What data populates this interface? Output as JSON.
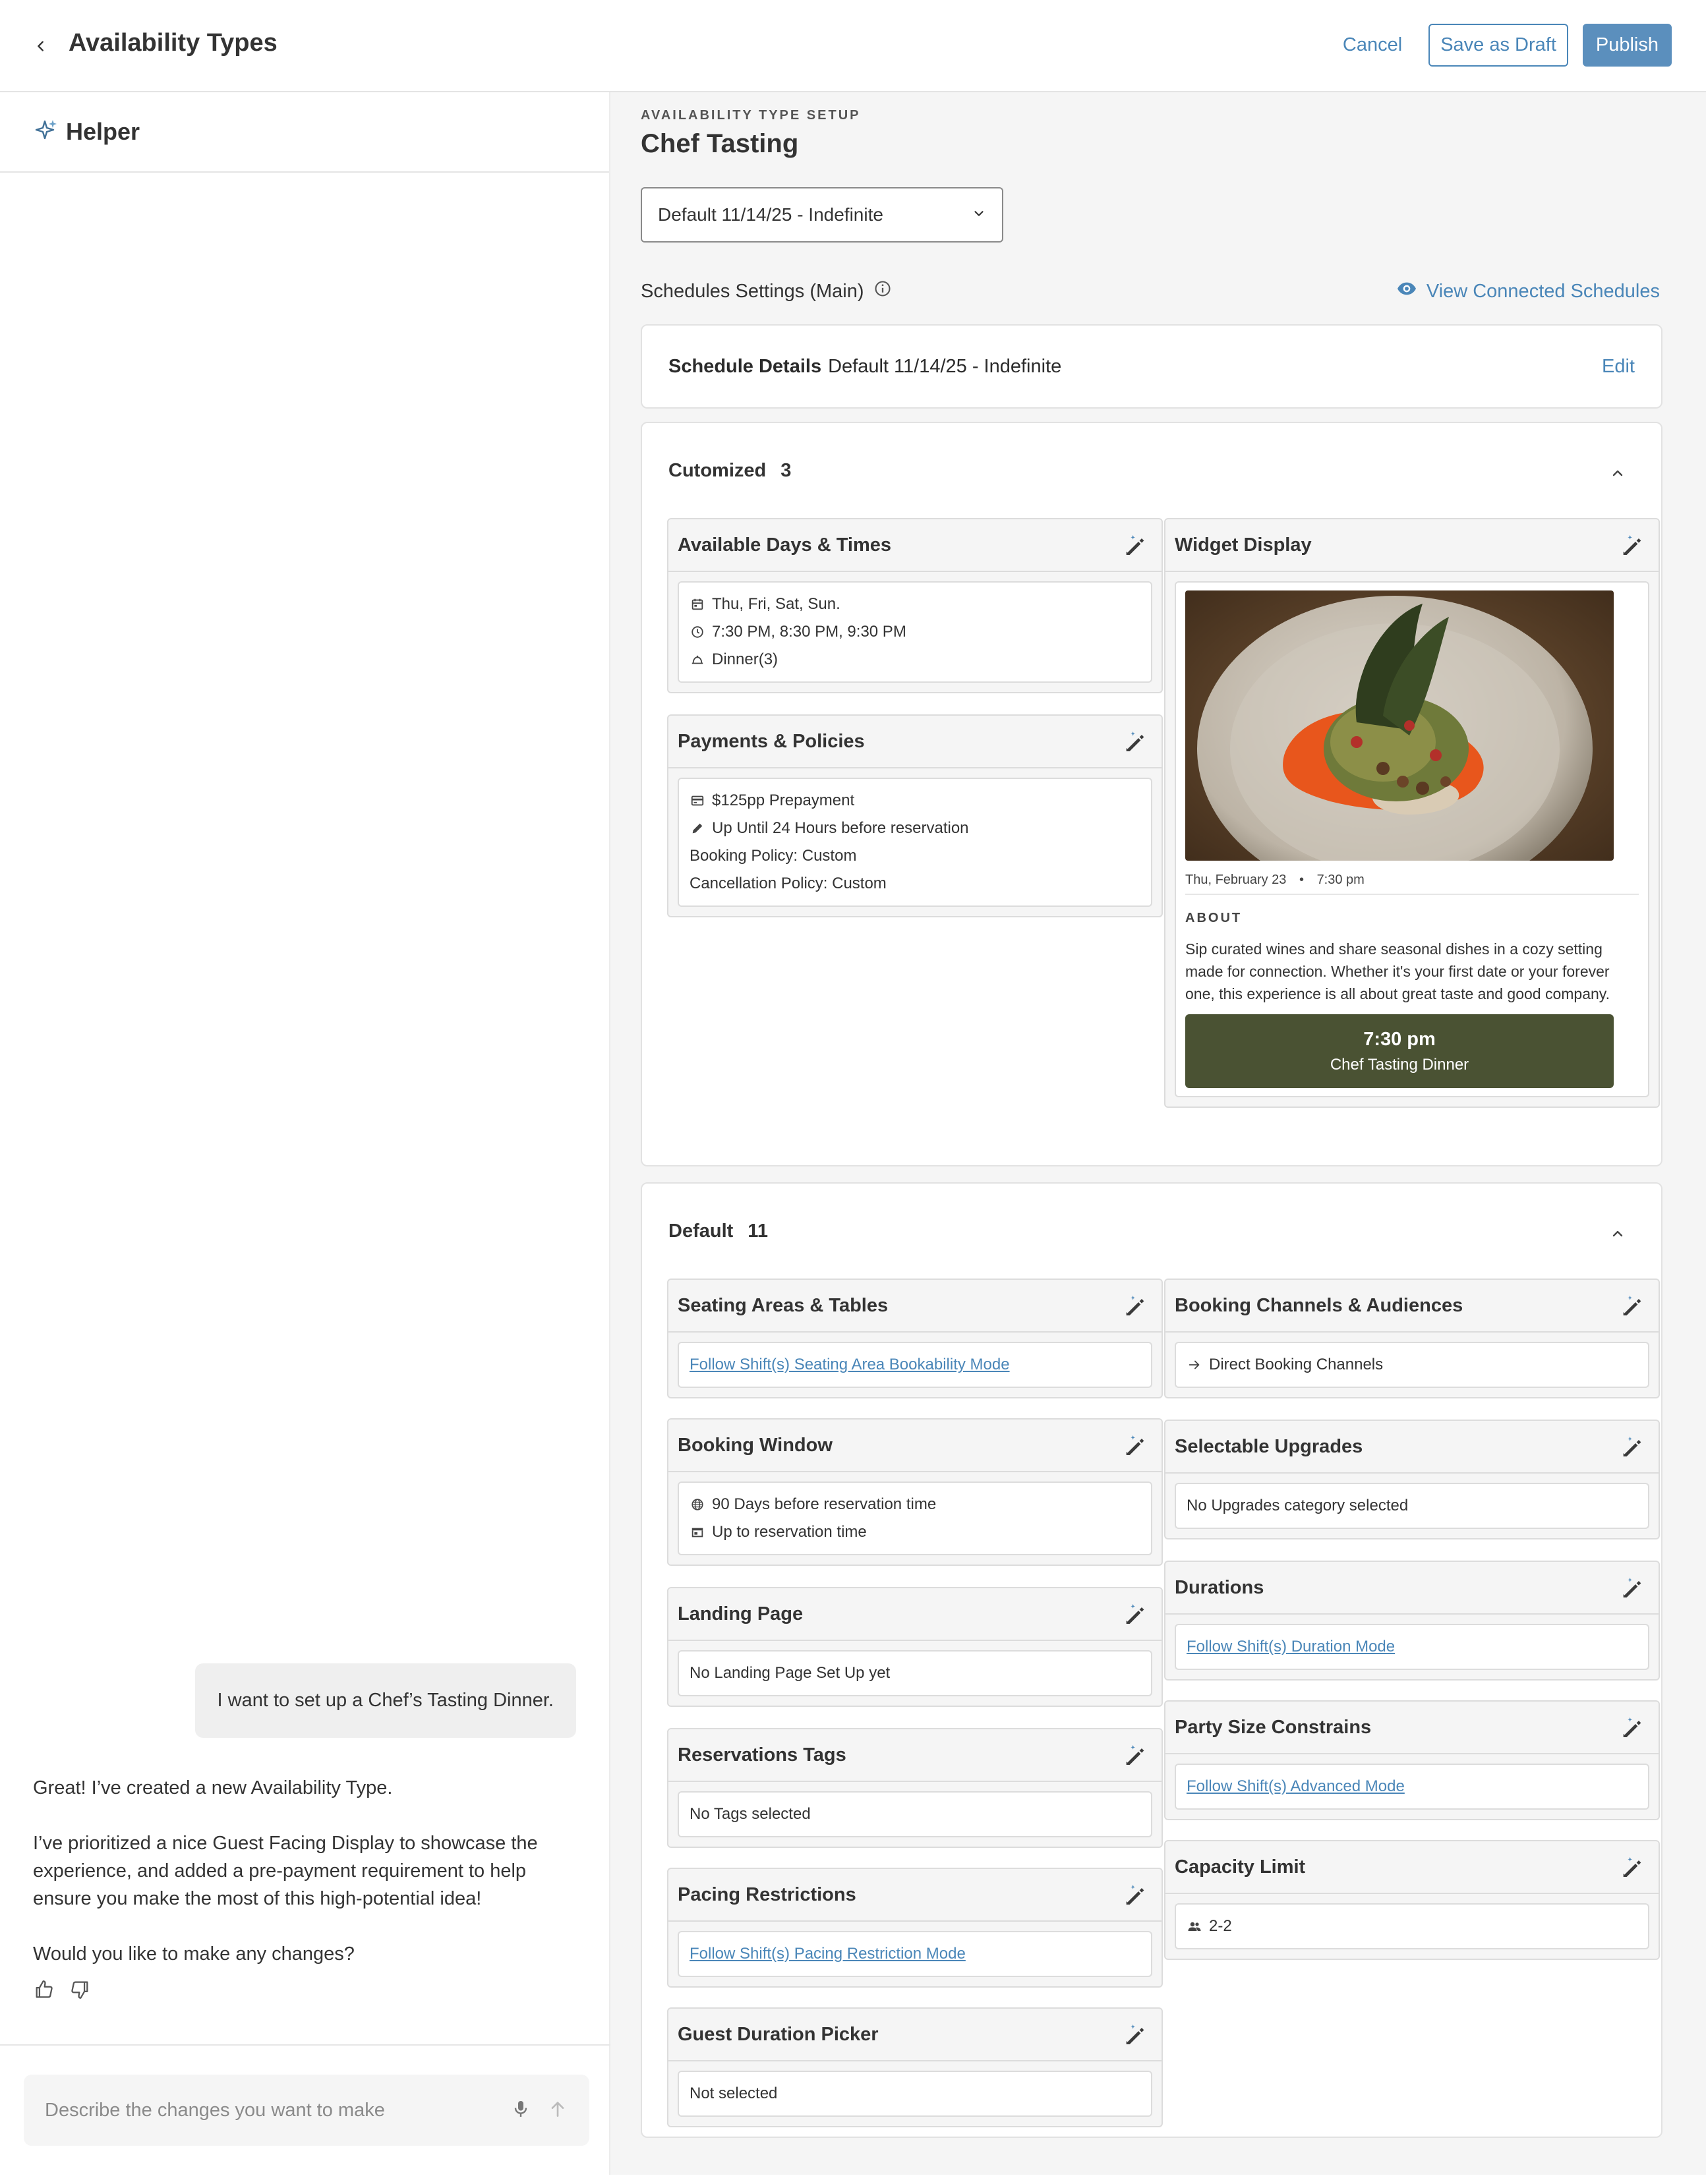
{
  "header": {
    "title": "Availability Types",
    "cancel": "Cancel",
    "save_draft": "Save as Draft",
    "publish": "Publish"
  },
  "helper": {
    "title": "Helper",
    "user_message": "I want to set up a Chef’s Tasting Dinner.",
    "assistant_paragraphs": [
      "Great! I’ve created a new Availability Type.",
      "I’ve prioritized a nice Guest Facing Display to showcase the experience, and added a pre-payment requirement to help ensure you make the most of this high-potential idea!",
      "Would you like to make any changes?"
    ],
    "input_placeholder": "Describe the changes you want to make"
  },
  "setup": {
    "eyebrow": "AVAILABILITY TYPE SETUP",
    "title": "Chef Tasting",
    "schedule_select": "Default 11/14/25 - Indefinite",
    "settings_label": "Schedules Settings (Main)",
    "view_connected": "View Connected Schedules",
    "details_label": "Schedule Details",
    "details_value": "Default 11/14/25 - Indefinite",
    "edit": "Edit"
  },
  "customized": {
    "label": "Cutomized",
    "count": "3",
    "available_days": {
      "title": "Available Days & Times",
      "days": "Thu, Fri, Sat, Sun.",
      "times": "7:30 PM, 8:30 PM, 9:30 PM",
      "meal": "Dinner(3)"
    },
    "payments": {
      "title": "Payments & Policies",
      "prepayment": "$125pp Prepayment",
      "until": "Up Until 24 Hours before reservation",
      "booking_policy": "Booking Policy: Custom",
      "cancellation_policy": "Cancellation Policy: Custom"
    },
    "widget": {
      "title": "Widget Display",
      "date": "Thu, February 23",
      "time": "7:30 pm",
      "about_label": "ABOUT",
      "about_text": "Sip curated wines and share seasonal dishes in a cozy setting made for connection. Whether it's your first date or your forever one, this experience is all about great taste and good company.",
      "button_time": "7:30 pm",
      "button_label": "Chef Tasting Dinner"
    }
  },
  "default": {
    "label": "Default",
    "count": "11",
    "seating": {
      "title": "Seating Areas & Tables",
      "value": "Follow Shift(s) Seating Area Bookability Mode"
    },
    "booking_window": {
      "title": "Booking Window",
      "before": "90 Days before reservation time",
      "upto": "Up to reservation time"
    },
    "landing": {
      "title": "Landing Page",
      "value": "No Landing Page Set Up yet"
    },
    "tags": {
      "title": "Reservations Tags",
      "value": "No Tags selected"
    },
    "pacing": {
      "title": "Pacing Restrictions",
      "value": "Follow Shift(s) Pacing Restriction Mode"
    },
    "guest_duration": {
      "title": "Guest Duration Picker",
      "value": "Not selected"
    },
    "channels": {
      "title": "Booking Channels & Audiences",
      "value": "Direct Booking Channels"
    },
    "upgrades": {
      "title": "Selectable Upgrades",
      "value": "No Upgrades category selected"
    },
    "durations": {
      "title": "Durations",
      "value": "Follow Shift(s) Duration Mode"
    },
    "party_size": {
      "title": "Party Size Constrains",
      "value": "Follow Shift(s) Advanced Mode"
    },
    "capacity": {
      "title": "Capacity Limit",
      "value": "2-2"
    }
  },
  "colors": {
    "accent": "#4a86b8",
    "primary_button": "#5b8fbd",
    "widget_button": "#4a5233"
  }
}
